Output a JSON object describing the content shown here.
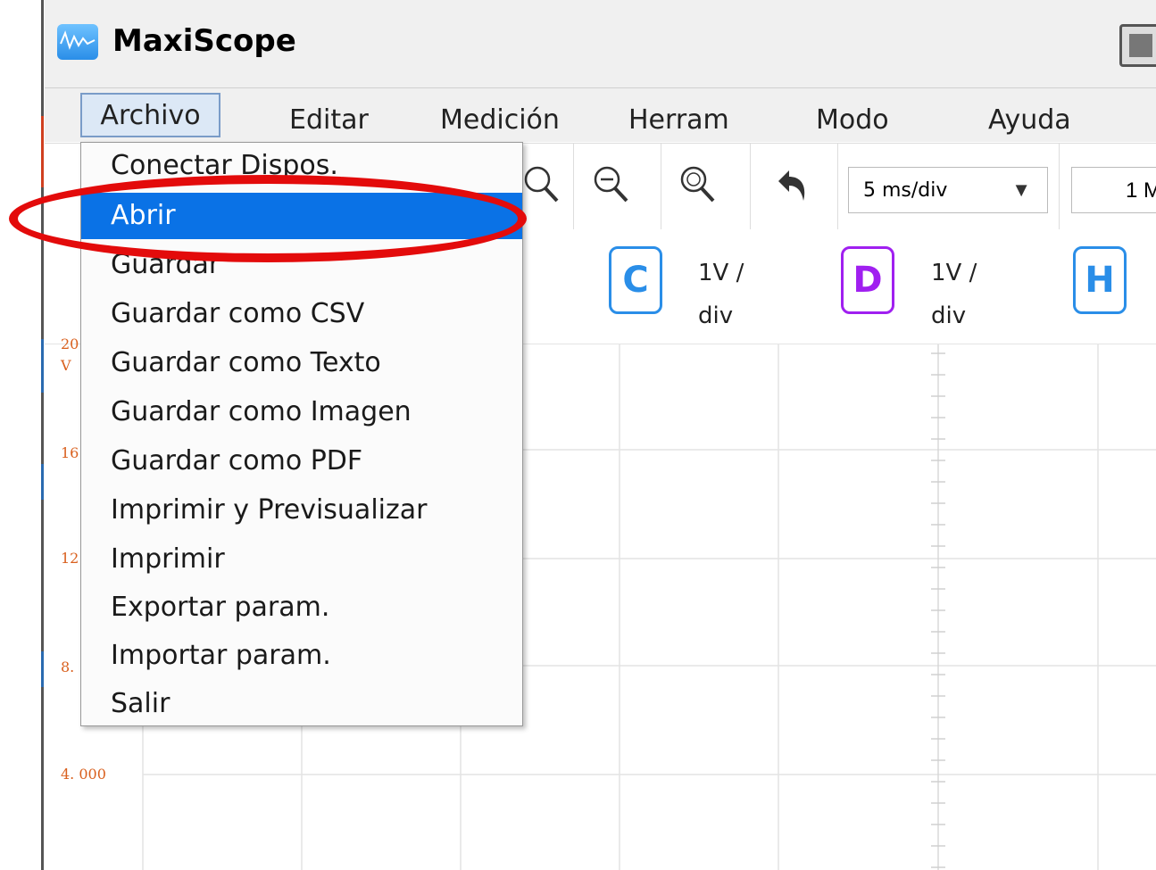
{
  "app": {
    "title": "MaxiScope"
  },
  "menubar": {
    "items": [
      {
        "label": "Archivo"
      },
      {
        "label": "Editar"
      },
      {
        "label": "Medición"
      },
      {
        "label": "Herram"
      },
      {
        "label": "Modo"
      },
      {
        "label": "Ayuda"
      }
    ]
  },
  "file_menu": {
    "items": [
      {
        "label": "Conectar Dispos."
      },
      {
        "label": "Abrir",
        "selected": true
      },
      {
        "label": "Guardar"
      },
      {
        "label": "Guardar como CSV"
      },
      {
        "label": "Guardar como Texto"
      },
      {
        "label": "Guardar como Imagen"
      },
      {
        "label": "Guardar como PDF"
      },
      {
        "label": "Imprimir y Previsualizar"
      },
      {
        "label": "Imprimir"
      },
      {
        "label": "Exportar param."
      },
      {
        "label": "Importar param."
      },
      {
        "label": "Salir"
      }
    ]
  },
  "toolbar": {
    "timebase": "5  ms/div",
    "timebase_arrow": "▼",
    "sample_partial": "1 M"
  },
  "channels": [
    {
      "letter": "C",
      "scale_line1": "1V /",
      "scale_line2": "div",
      "color": "#2a8ee8"
    },
    {
      "letter": "D",
      "scale_line1": "1V /",
      "scale_line2": "div",
      "color": "#a020f0"
    },
    {
      "letter": "H",
      "scale_line1": "",
      "scale_line2": "",
      "color": "#2a8ee8"
    }
  ],
  "plot": {
    "y_labels": [
      "20",
      "V",
      "16",
      "12",
      "8.",
      "4. 000"
    ]
  },
  "colors": {
    "selection": "#0a72e6",
    "highlight": "#e30b0b",
    "axis_label": "#d9601e"
  }
}
